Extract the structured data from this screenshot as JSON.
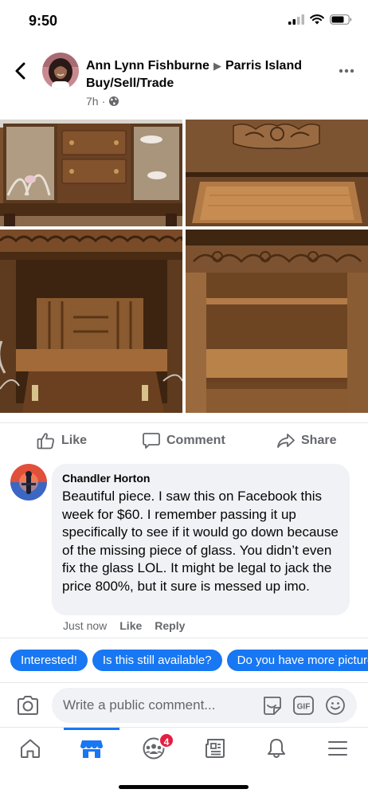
{
  "status_bar": {
    "time": "9:50"
  },
  "post": {
    "author": "Ann Lynn Fishburne",
    "group": "Parris Island Buy/Sell/Trade",
    "time": "7h",
    "photos": [
      {
        "icon": "photo-cabinet-glass-doors"
      },
      {
        "icon": "photo-carved-drawer-open"
      },
      {
        "icon": "photo-secretary-desk-interior"
      },
      {
        "icon": "photo-cabinet-shelves"
      }
    ]
  },
  "actions": {
    "like": "Like",
    "comment": "Comment",
    "share": "Share"
  },
  "comment": {
    "author": "Chandler Horton",
    "text": "Beautiful piece. I saw this on Facebook this week for $60.  I remember passing it up specifically to see if it would go down because of the missing piece of glass. You didn’t even fix the glass LOL. It might be legal to jack the price 800%, but it sure is messed up imo.",
    "time": "Just now",
    "like": "Like",
    "reply": "Reply"
  },
  "quick_replies": [
    "Interested!",
    "Is this still available?",
    "Do you have more pictures?"
  ],
  "composer": {
    "placeholder": "Write a public comment..."
  },
  "tabbar": {
    "groups_badge": "4"
  },
  "colors": {
    "accent": "#1877f2",
    "badge": "#e41e3f",
    "secondary_text": "#65676b",
    "bubble": "#f0f2f5"
  }
}
